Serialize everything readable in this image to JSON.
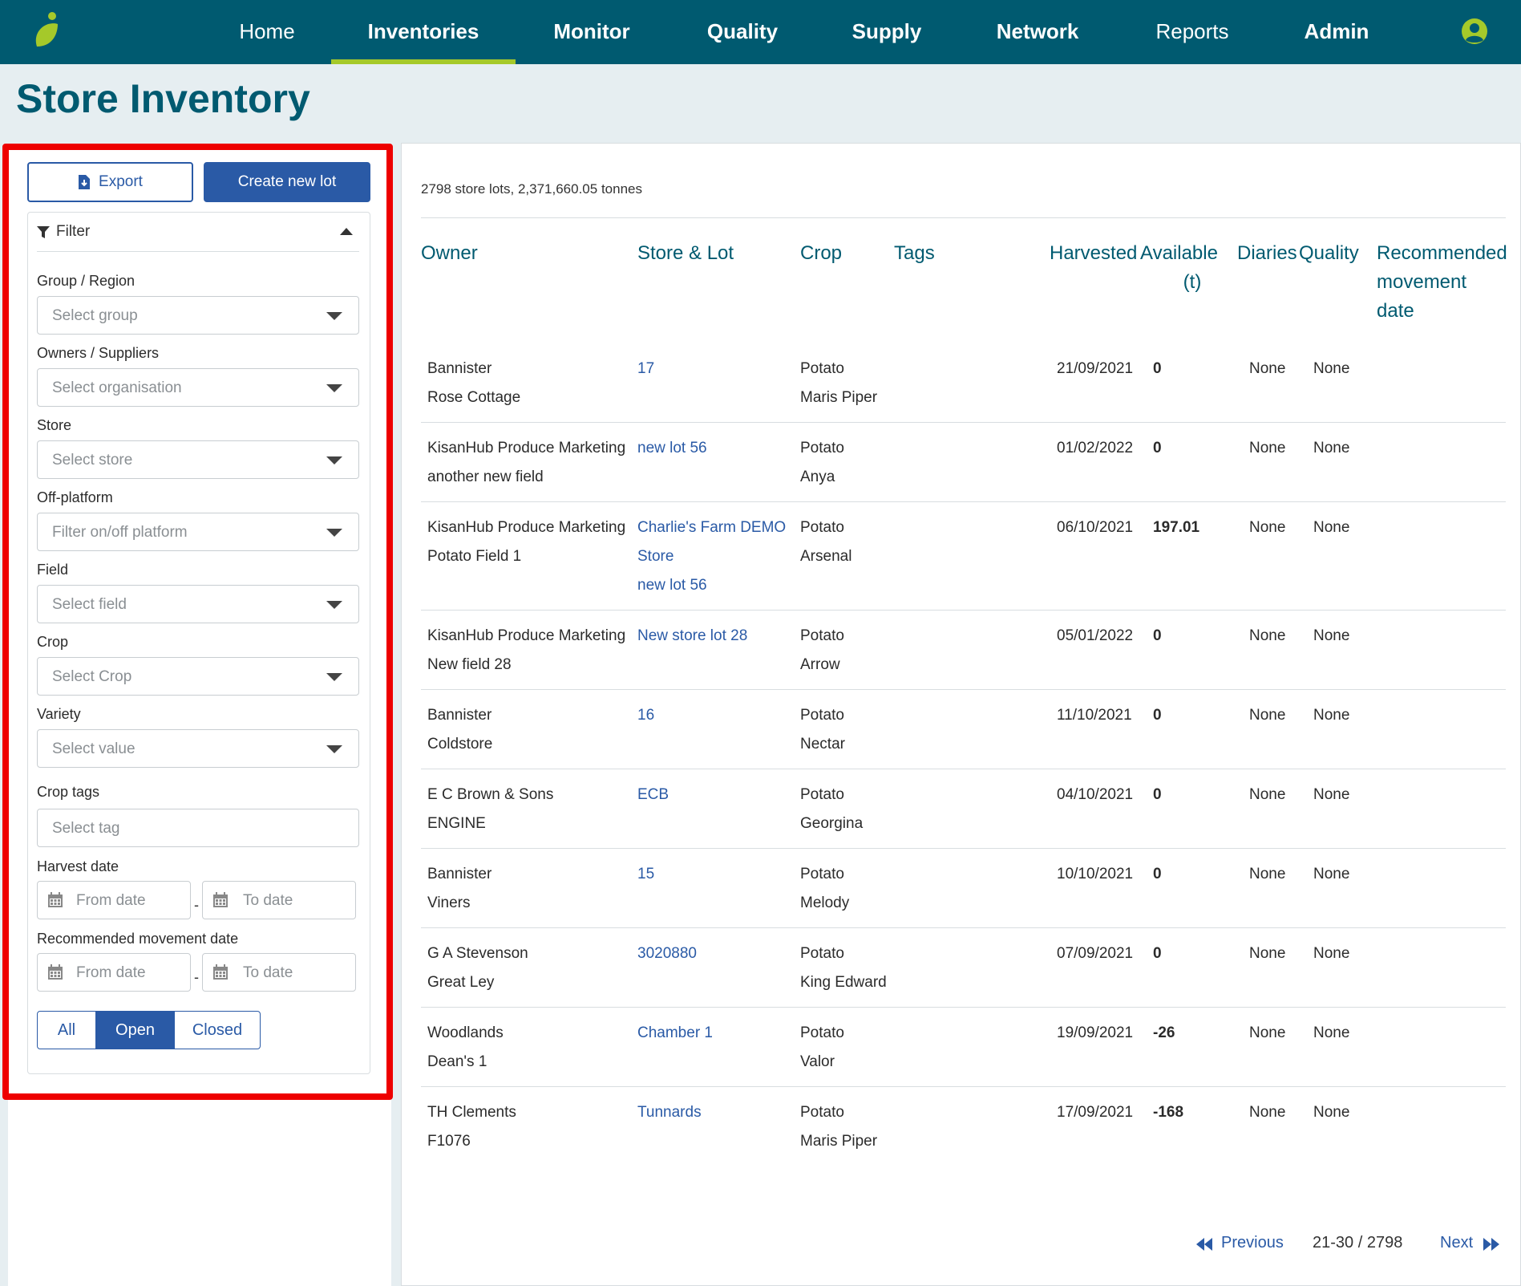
{
  "nav": {
    "items": [
      {
        "label": "Home"
      },
      {
        "label": "Inventories"
      },
      {
        "label": "Monitor"
      },
      {
        "label": "Quality"
      },
      {
        "label": "Supply"
      },
      {
        "label": "Network"
      },
      {
        "label": "Reports"
      },
      {
        "label": "Admin"
      }
    ],
    "active": "Inventories"
  },
  "page": {
    "title": "Store Inventory"
  },
  "actions": {
    "export_label": "Export",
    "create_label": "Create new lot"
  },
  "filter": {
    "title": "Filter",
    "group_region": {
      "label": "Group / Region",
      "placeholder": "Select group"
    },
    "owners": {
      "label": "Owners / Suppliers",
      "placeholder": "Select organisation"
    },
    "store": {
      "label": "Store",
      "placeholder": "Select store"
    },
    "off_platform": {
      "label": "Off-platform",
      "placeholder": "Filter on/off platform"
    },
    "field": {
      "label": "Field",
      "placeholder": "Select field"
    },
    "crop": {
      "label": "Crop",
      "placeholder": "Select Crop"
    },
    "variety": {
      "label": "Variety",
      "placeholder": "Select value"
    },
    "crop_tags": {
      "label": "Crop tags",
      "placeholder": "Select tag"
    },
    "harvest_date": {
      "label": "Harvest date",
      "from": "From date",
      "to": "To date",
      "sep": "-"
    },
    "movement_date": {
      "label": "Recommended movement date",
      "from": "From date",
      "to": "To date",
      "sep": "-"
    },
    "status": {
      "all": "All",
      "open": "Open",
      "closed": "Closed",
      "selected": "Open"
    }
  },
  "summary": "2798 store lots, 2,371,660.05 tonnes",
  "table": {
    "headers": {
      "owner": "Owner",
      "store_lot": "Store & Lot",
      "crop": "Crop",
      "tags": "Tags",
      "harvested": "Harvested",
      "available_1": "Available",
      "available_2": "(t)",
      "diaries": "Diaries",
      "quality": "Quality",
      "recommended_1": "Recommended",
      "recommended_2": "movement",
      "recommended_3": "date"
    },
    "rows": [
      {
        "owner": "Bannister",
        "field": "Rose Cottage",
        "store": "17",
        "store2": "",
        "lot": "",
        "crop": "Potato",
        "variety": "Maris Piper",
        "harvested": "21/09/2021",
        "available": "0",
        "diaries": "None",
        "quality": "None"
      },
      {
        "owner": "KisanHub Produce Marketing",
        "field": "another new field",
        "store": "new lot 56",
        "store2": "",
        "lot": "",
        "crop": "Potato",
        "variety": "Anya",
        "harvested": "01/02/2022",
        "available": "0",
        "diaries": "None",
        "quality": "None"
      },
      {
        "owner": "KisanHub Produce Marketing",
        "field": "Potato Field 1",
        "store": "Charlie's Farm DEMO",
        "store2": "Store",
        "lot": "new lot 56",
        "crop": "Potato",
        "variety": "Arsenal",
        "harvested": "06/10/2021",
        "available": "197.01",
        "diaries": "None",
        "quality": "None"
      },
      {
        "owner": "KisanHub Produce Marketing",
        "field": "New field 28",
        "store": "New store lot 28",
        "store2": "",
        "lot": "",
        "crop": "Potato",
        "variety": "Arrow",
        "harvested": "05/01/2022",
        "available": "0",
        "diaries": "None",
        "quality": "None"
      },
      {
        "owner": "Bannister",
        "field": "Coldstore",
        "store": "16",
        "store2": "",
        "lot": "",
        "crop": "Potato",
        "variety": "Nectar",
        "harvested": "11/10/2021",
        "available": "0",
        "diaries": "None",
        "quality": "None"
      },
      {
        "owner": "E C Brown & Sons",
        "field": "ENGINE",
        "store": "ECB",
        "store2": "",
        "lot": "",
        "crop": "Potato",
        "variety": "Georgina",
        "harvested": "04/10/2021",
        "available": "0",
        "diaries": "None",
        "quality": "None"
      },
      {
        "owner": "Bannister",
        "field": "Viners",
        "store": "15",
        "store2": "",
        "lot": "",
        "crop": "Potato",
        "variety": "Melody",
        "harvested": "10/10/2021",
        "available": "0",
        "diaries": "None",
        "quality": "None"
      },
      {
        "owner": "G A Stevenson",
        "field": "Great Ley",
        "store": "3020880",
        "store2": "",
        "lot": "",
        "crop": "Potato",
        "variety": "King Edward",
        "harvested": "07/09/2021",
        "available": "0",
        "diaries": "None",
        "quality": "None"
      },
      {
        "owner": "Woodlands",
        "field": "Dean's 1",
        "store": "Chamber 1",
        "store2": "",
        "lot": "",
        "crop": "Potato",
        "variety": "Valor",
        "harvested": "19/09/2021",
        "available": "-26",
        "diaries": "None",
        "quality": "None"
      },
      {
        "owner": "TH Clements",
        "field": "F1076",
        "store": "Tunnards",
        "store2": "",
        "lot": "",
        "crop": "Potato",
        "variety": "Maris Piper",
        "harvested": "17/09/2021",
        "available": "-168",
        "diaries": "None",
        "quality": "None"
      }
    ]
  },
  "pagination": {
    "previous": "Previous",
    "range": "21-30 / 2798",
    "next": "Next"
  },
  "colors": {
    "nav_bg": "#005a70",
    "accent": "#a5c92a",
    "primary": "#2a5aa6",
    "highlight": "#ee0000"
  }
}
